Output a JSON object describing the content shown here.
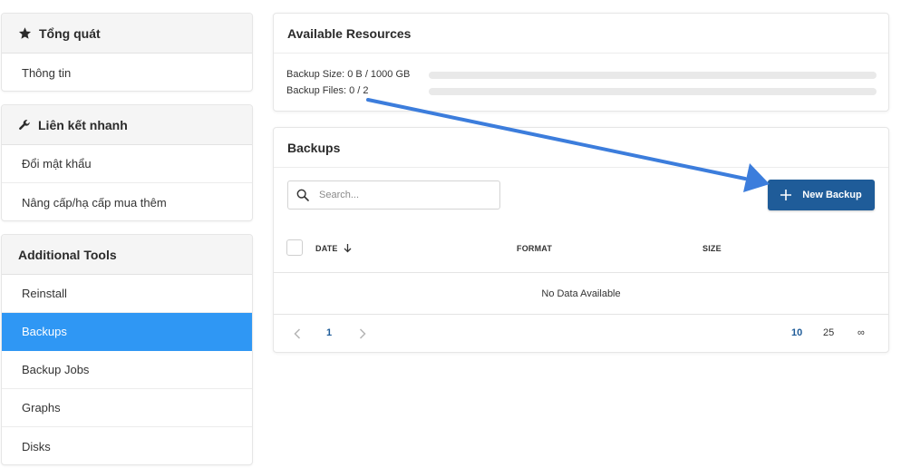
{
  "sidebar": {
    "overview": {
      "title": "Tổng quát",
      "items": [
        "Thông tin"
      ]
    },
    "quicklinks": {
      "title": "Liên kết nhanh",
      "items": [
        "Đổi mật khẩu",
        "Nâng cấp/hạ cấp mua thêm"
      ]
    },
    "tools": {
      "title": "Additional Tools",
      "items": [
        "Reinstall",
        "Backups",
        "Backup Jobs",
        "Graphs",
        "Disks"
      ],
      "active": "Backups"
    }
  },
  "resources": {
    "title": "Available Resources",
    "size_label": "Backup Size: 0 B / 1000 GB",
    "size_fraction": 0,
    "files_label": "Backup Files: 0 / 2",
    "files_fraction": 0
  },
  "backups": {
    "title": "Backups",
    "search_placeholder": "Search...",
    "new_button": "New Backup",
    "columns": [
      "DATE",
      "FORMAT",
      "SIZE"
    ],
    "empty": "No Data Available",
    "pagination": {
      "current_page": "1",
      "page_sizes": [
        "10",
        "25",
        "∞"
      ],
      "selected_size": "10"
    }
  },
  "colors": {
    "accent": "#2f97f4",
    "button": "#1f5c99",
    "arrow": "#3c7ddc"
  }
}
